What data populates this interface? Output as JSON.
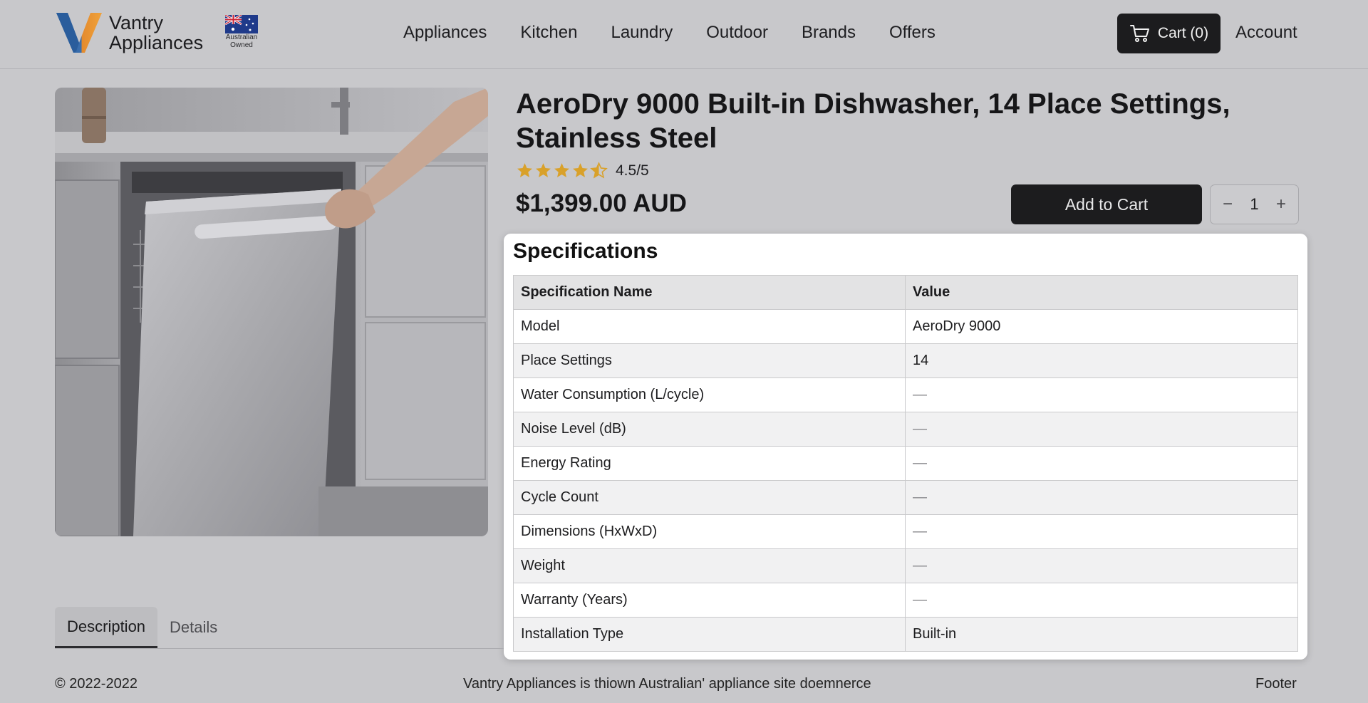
{
  "brand": {
    "name_line1": "Vantry",
    "name_line2": "Appliances",
    "badge_line1": "Australian",
    "badge_line2": "Owned",
    "accent_orange": "#e38a2d",
    "accent_blue": "#2a5d9c"
  },
  "nav": {
    "items": [
      "Appliances",
      "Kitchen",
      "Laundry",
      "Outdoor",
      "Brands",
      "Offers"
    ]
  },
  "header": {
    "cart_label": "Cart (0)",
    "cart_icon": "cart-icon",
    "account_label": "Account"
  },
  "product": {
    "title": "AeroDry 9000 Built-in Dishwasher, 14 Place Settings, Stainless Steel",
    "rating_value": 4.5,
    "rating_max": 5,
    "rating_text": "4.5/5",
    "star_color": "#d9a12a",
    "price": "$1,399.00 AUD",
    "add_to_cart_label": "Add to Cart",
    "quantity": "1",
    "qty_minus": "−",
    "qty_plus": "+"
  },
  "specs": {
    "heading": "Specifications",
    "columns": [
      "Specification Name",
      "Value"
    ],
    "rows": [
      [
        "Model",
        "AeroDry 9000"
      ],
      [
        "Place Settings",
        "14"
      ],
      [
        "Water Consumption (L/cycle)",
        "—"
      ],
      [
        "Noise Level (dB)",
        "—"
      ],
      [
        "Energy Rating",
        "—"
      ],
      [
        "Cycle Count",
        "—"
      ],
      [
        "Dimensions (HxWxD)",
        "—"
      ],
      [
        "Weight",
        "—"
      ],
      [
        "Warranty (Years)",
        "—"
      ],
      [
        "Installation Type",
        "Built-in"
      ]
    ]
  },
  "tabs": {
    "items": [
      "Description",
      "Details"
    ],
    "active": 0
  },
  "footer": {
    "copyright": "© 2022-2022",
    "tagline": "Vantry Appliances is thiown Australian' appliance site doemnerce",
    "link": "Footer"
  }
}
